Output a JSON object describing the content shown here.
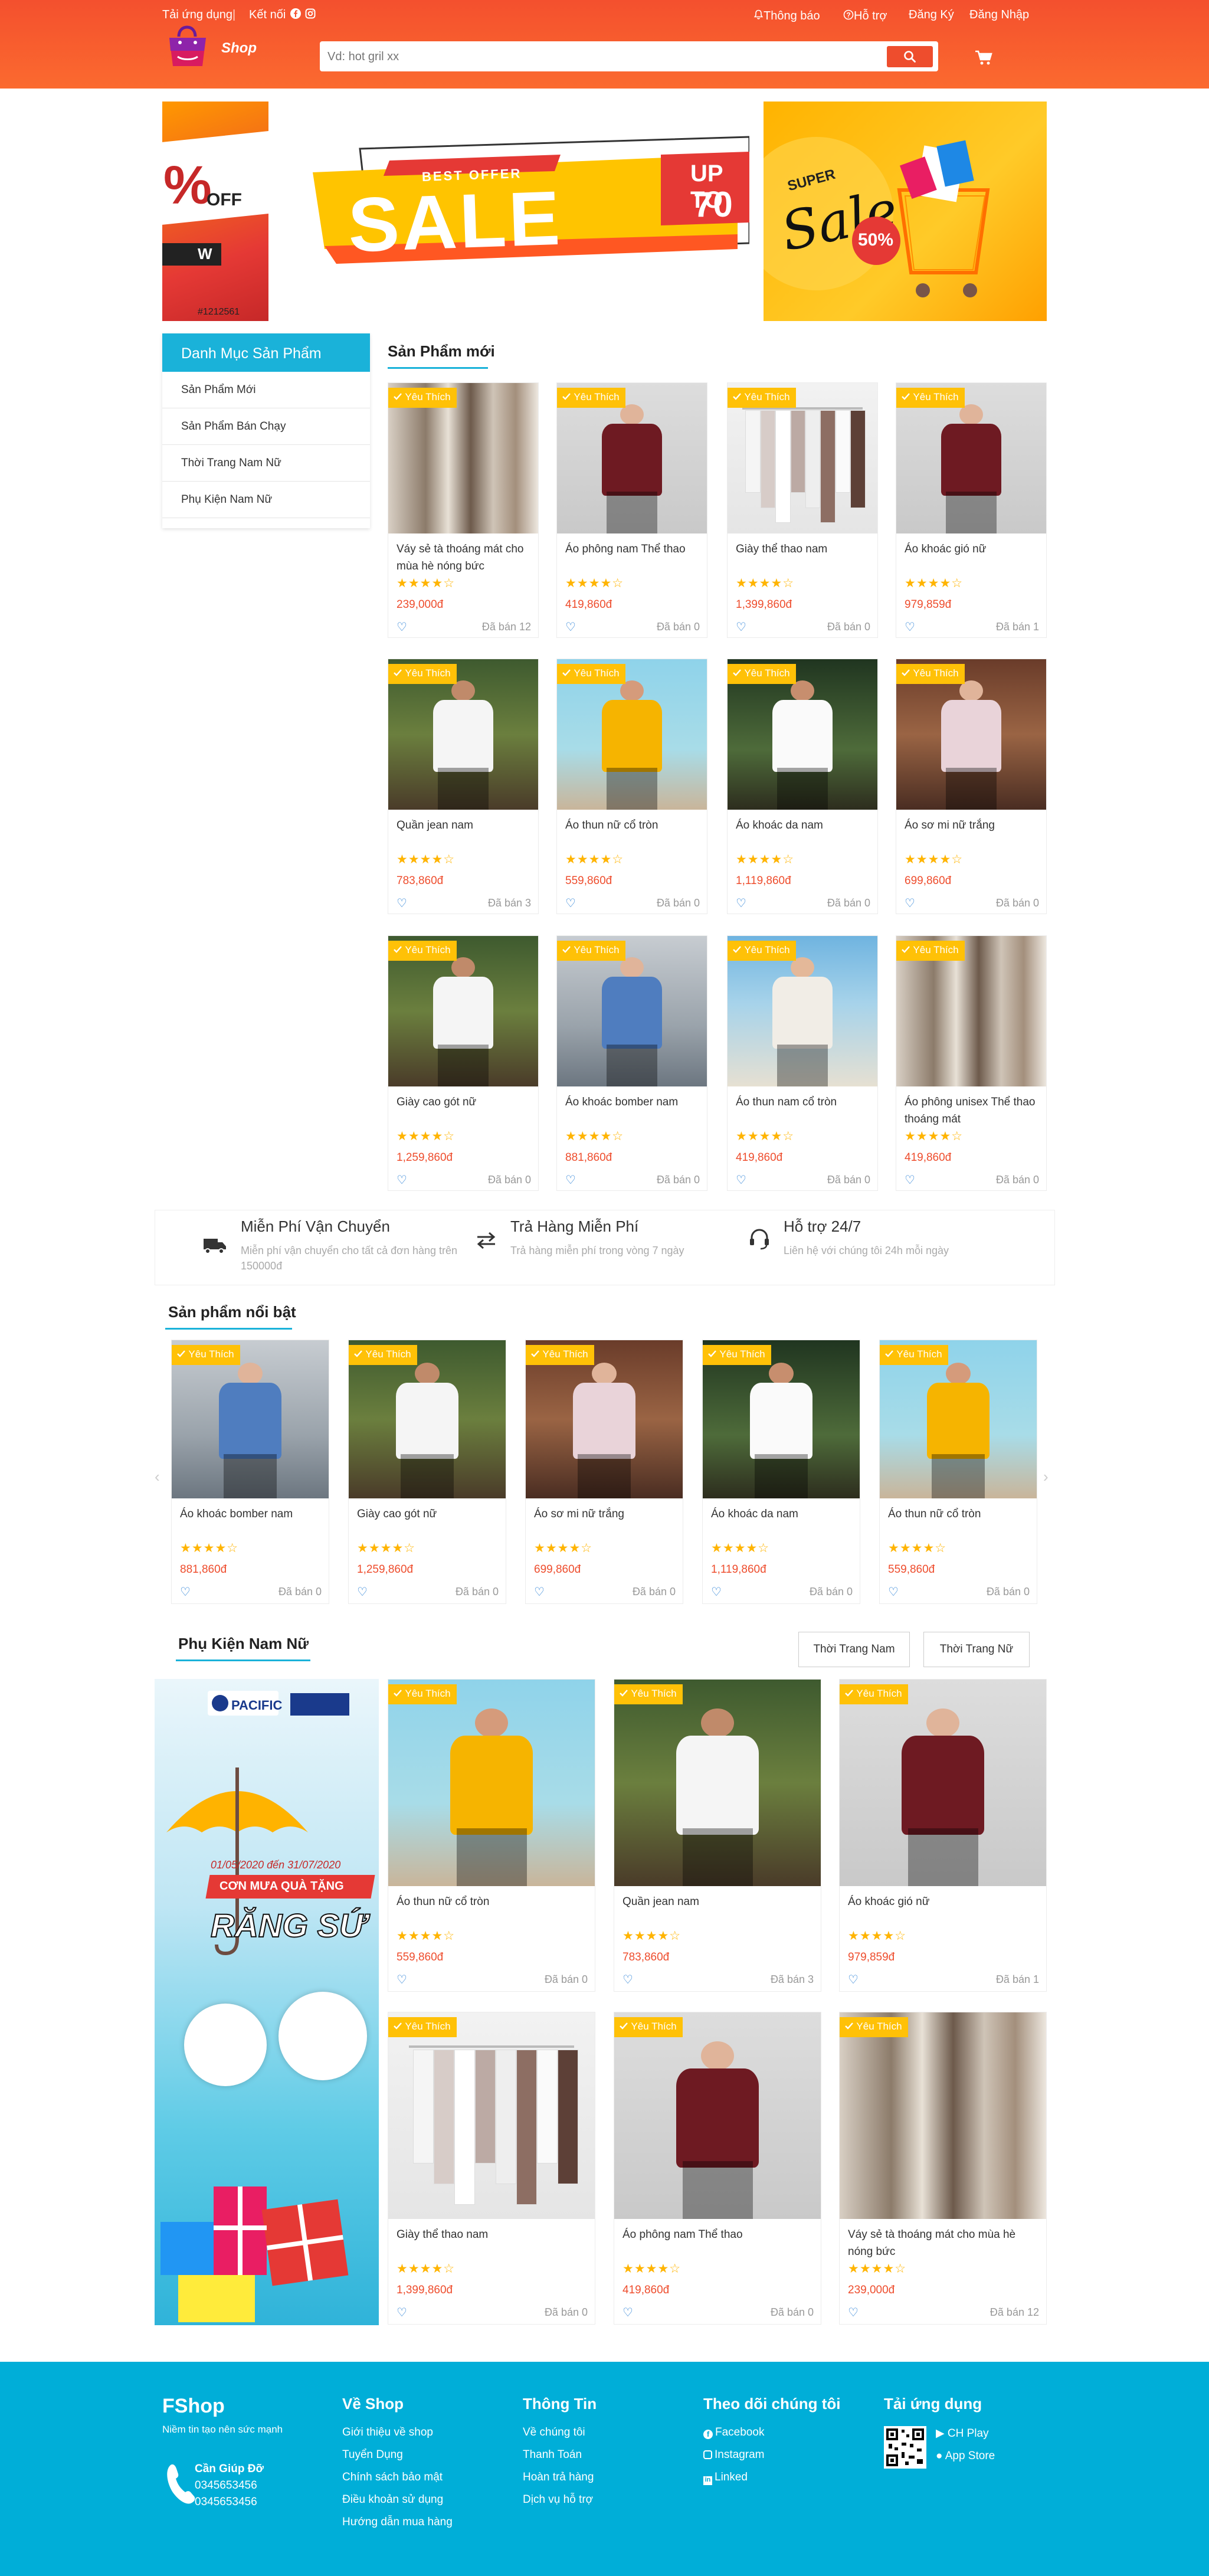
{
  "header": {
    "download_app": "Tải ứng dụng",
    "connect": "Kết nối",
    "notifications": "Thông báo",
    "support": "Hỗ trợ",
    "register": "Đăng Ký",
    "login": "Đăng Nhập",
    "logo_text": "Shop",
    "search_placeholder": "Vd: hot gril xx"
  },
  "banners": {
    "left_percent": "%",
    "left_off": "OFF",
    "left_code": "#1212561",
    "center_best_offer": "BEST OFFER",
    "center_sale": "SALE",
    "center_up_to": "UP TO",
    "center_70": "70",
    "right_super": "SUPER",
    "right_sale": "Sale",
    "right_50": "50%"
  },
  "sidebar": {
    "title": "Danh Mục Sản Phẩm",
    "items": [
      "Sản Phẩm Mới",
      "Sản Phẩm Bán Chạy",
      "Thời Trang Nam Nữ",
      "Phụ Kiện Nam Nữ"
    ]
  },
  "new_products": {
    "title": "Sản Phẩm mới",
    "items": [
      {
        "name": "Váy sẻ tà thoáng mát cho mùa hè nóng bức",
        "price": "239,000đ",
        "sold": "Đã bán 12"
      },
      {
        "name": "Áo phông nam Thể thao",
        "price": "419,860đ",
        "sold": "Đã bán 0"
      },
      {
        "name": "Giày thể thao nam",
        "price": "1,399,860đ",
        "sold": "Đã bán 0"
      },
      {
        "name": "Áo khoác gió nữ",
        "price": "979,859đ",
        "sold": "Đã bán 1"
      },
      {
        "name": "Quần jean nam",
        "price": "783,860đ",
        "sold": "Đã bán 3"
      },
      {
        "name": "Áo thun nữ cổ tròn",
        "price": "559,860đ",
        "sold": "Đã bán 0"
      },
      {
        "name": "Áo khoác da nam",
        "price": "1,119,860đ",
        "sold": "Đã bán 0"
      },
      {
        "name": "Áo sơ mi nữ trắng",
        "price": "699,860đ",
        "sold": "Đã bán 0"
      },
      {
        "name": "Giày cao gót nữ",
        "price": "1,259,860đ",
        "sold": "Đã bán 0"
      },
      {
        "name": "Áo khoác bomber nam",
        "price": "881,860đ",
        "sold": "Đã bán 0"
      },
      {
        "name": "Áo thun nam cổ tròn",
        "price": "419,860đ",
        "sold": "Đã bán 0"
      },
      {
        "name": "Áo phông unisex Thể thao thoáng mát",
        "price": "419,860đ",
        "sold": "Đã bán 0"
      }
    ]
  },
  "badge": "Yêu Thích",
  "stars": "★★★★☆",
  "heart": "♡",
  "policies": [
    {
      "title": "Miễn Phí Vận Chuyển",
      "desc": "Miễn phí vận chuyển cho tất cả đơn hàng trên 150000đ"
    },
    {
      "title": "Trả Hàng Miễn Phí",
      "desc": "Trả hàng miễn phí trong vòng 7 ngày"
    },
    {
      "title": "Hỗ trợ 24/7",
      "desc": "Liên hệ với chúng tôi 24h mỗi ngày"
    }
  ],
  "featured": {
    "title": "Sản phẩm nổi bật",
    "items": [
      {
        "name": "Áo khoác bomber nam",
        "price": "881,860đ",
        "sold": "Đã bán 0"
      },
      {
        "name": "Giày cao gót nữ",
        "price": "1,259,860đ",
        "sold": "Đã bán 0"
      },
      {
        "name": "Áo sơ mi nữ trắng",
        "price": "699,860đ",
        "sold": "Đã bán 0"
      },
      {
        "name": "Áo khoác da nam",
        "price": "1,119,860đ",
        "sold": "Đã bán 0"
      },
      {
        "name": "Áo thun nữ cổ tròn",
        "price": "559,860đ",
        "sold": "Đã bán 0"
      }
    ]
  },
  "accessories": {
    "title": "Phụ Kiện Nam Nữ",
    "tab1": "Thời Trang Nam",
    "tab2": "Thời Trang Nữ",
    "promo_brand": "PACIFIC",
    "promo_date": "01/05/2020 đến 31/07/2020",
    "promo_ribbon": "CƠN MƯA QUÀ TẶNG",
    "promo_title": "RĂNG SỨ",
    "items": [
      {
        "name": "Áo thun nữ cổ tròn",
        "price": "559,860đ",
        "sold": "Đã bán 0"
      },
      {
        "name": "Quần jean nam",
        "price": "783,860đ",
        "sold": "Đã bán 3"
      },
      {
        "name": "Áo khoác gió nữ",
        "price": "979,859đ",
        "sold": "Đã bán 1"
      },
      {
        "name": "Giày thể thao nam",
        "price": "1,399,860đ",
        "sold": "Đã bán 0"
      },
      {
        "name": "Áo phông nam Thể thao",
        "price": "419,860đ",
        "sold": "Đã bán 0"
      },
      {
        "name": "Váy sẻ tà thoáng mát cho mùa hè nóng bức",
        "price": "239,000đ",
        "sold": "Đã bán 12"
      }
    ]
  },
  "footer": {
    "brand": "FShop",
    "tagline": "Niềm tin tạo nên sức mạnh",
    "help_label": "Cần Giúp Đỡ",
    "phone1": "0345653456",
    "phone2": "0345653456",
    "col_about": {
      "title": "Về Shop",
      "links": [
        "Giới thiệu về shop",
        "Tuyển Dụng",
        "Chính sách bảo mật",
        "Điều khoản sử dụng",
        "Hướng dẫn mua hàng"
      ]
    },
    "col_info": {
      "title": "Thông Tin",
      "links": [
        "Về chúng tôi",
        "Thanh Toán",
        "Hoàn trả hàng",
        "Dịch vụ hỗ trợ"
      ]
    },
    "col_follow": {
      "title": "Theo dõi chúng tôi",
      "links": [
        "Facebook",
        "Instagram",
        "Linked"
      ]
    },
    "col_app": {
      "title": "Tải ứng dụng",
      "links": [
        "CH Play",
        "App Store"
      ]
    }
  },
  "colors": {
    "header": "#f4502e",
    "accent": "#1ab2d9",
    "price": "#ee4d2d",
    "badge": "#ffc107",
    "footer": "#00aed8",
    "star": "#ffb400"
  }
}
